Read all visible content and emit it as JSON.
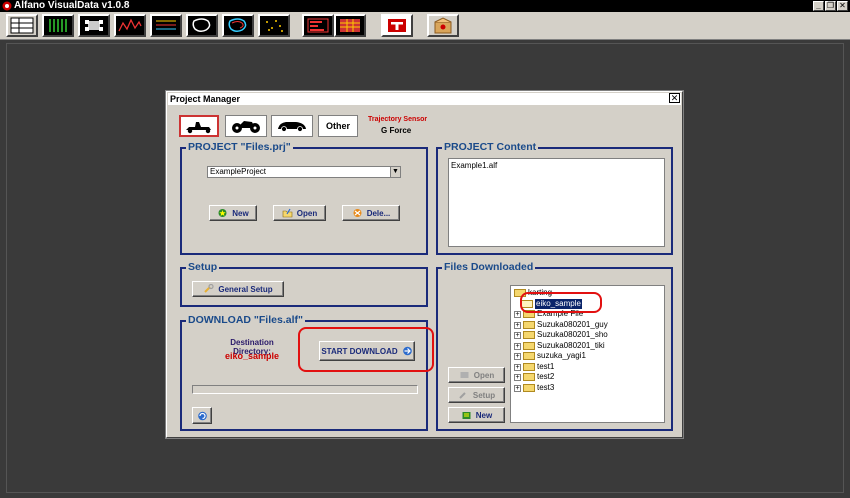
{
  "app": {
    "title": "Alfano VisualData v1.0.8",
    "window_controls": [
      "_",
      "❐",
      "✕"
    ]
  },
  "toolbar": {
    "buttons": [
      "table-view-icon",
      "data-columns-icon",
      "kart-setup-icon",
      "line-graph-icon",
      "multi-line-icon",
      "track-map-icon",
      "track-overlay-icon",
      "scatter-icon",
      "histogram-icon",
      "lap-table-icon",
      "alfano-logo-icon",
      "project-manager-icon"
    ]
  },
  "dialog": {
    "title": "Project Manager",
    "close": "✕",
    "vehicles": {
      "other_label": "Other"
    },
    "trajectory": {
      "label": "Trajectory Sensor",
      "value": "G Force"
    },
    "project": {
      "title": "PROJECT \"Files.prj\"",
      "selected": "ExampleProject",
      "new_label": "New",
      "open_label": "Open",
      "delete_label": "Dele..."
    },
    "content": {
      "title": "PROJECT Content",
      "items": [
        "Example1.alf"
      ]
    },
    "setup": {
      "title": "Setup",
      "general_label": "General Setup"
    },
    "download": {
      "title": "DOWNLOAD \"Files.alf\"",
      "dest_label": "Destination Directory:",
      "dest_value": "eiko_sample",
      "start_label": "START DOWNLOAD"
    },
    "files": {
      "title": "Files Downloaded",
      "open_label": "Open",
      "setup_label": "Setup",
      "new_label": "New",
      "tree": [
        {
          "label": "karting",
          "expander": "",
          "level": 0
        },
        {
          "label": "eiko_sample",
          "expander": "",
          "level": 1
        },
        {
          "label": "Example File",
          "expander": "+",
          "level": 1
        },
        {
          "label": "Suzuka080201_guy",
          "expander": "+",
          "level": 1
        },
        {
          "label": "Suzuka080201_sho",
          "expander": "+",
          "level": 1
        },
        {
          "label": "Suzuka080201_tiki",
          "expander": "+",
          "level": 1
        },
        {
          "label": "suzuka_yagi1",
          "expander": "+",
          "level": 1
        },
        {
          "label": "test1",
          "expander": "+",
          "level": 1
        },
        {
          "label": "test2",
          "expander": "+",
          "level": 1
        },
        {
          "label": "test3",
          "expander": "+",
          "level": 1
        }
      ]
    }
  },
  "colors": {
    "accent": "#1a4a8a",
    "highlight": "#e21010",
    "dest_value": "#cc0000"
  }
}
